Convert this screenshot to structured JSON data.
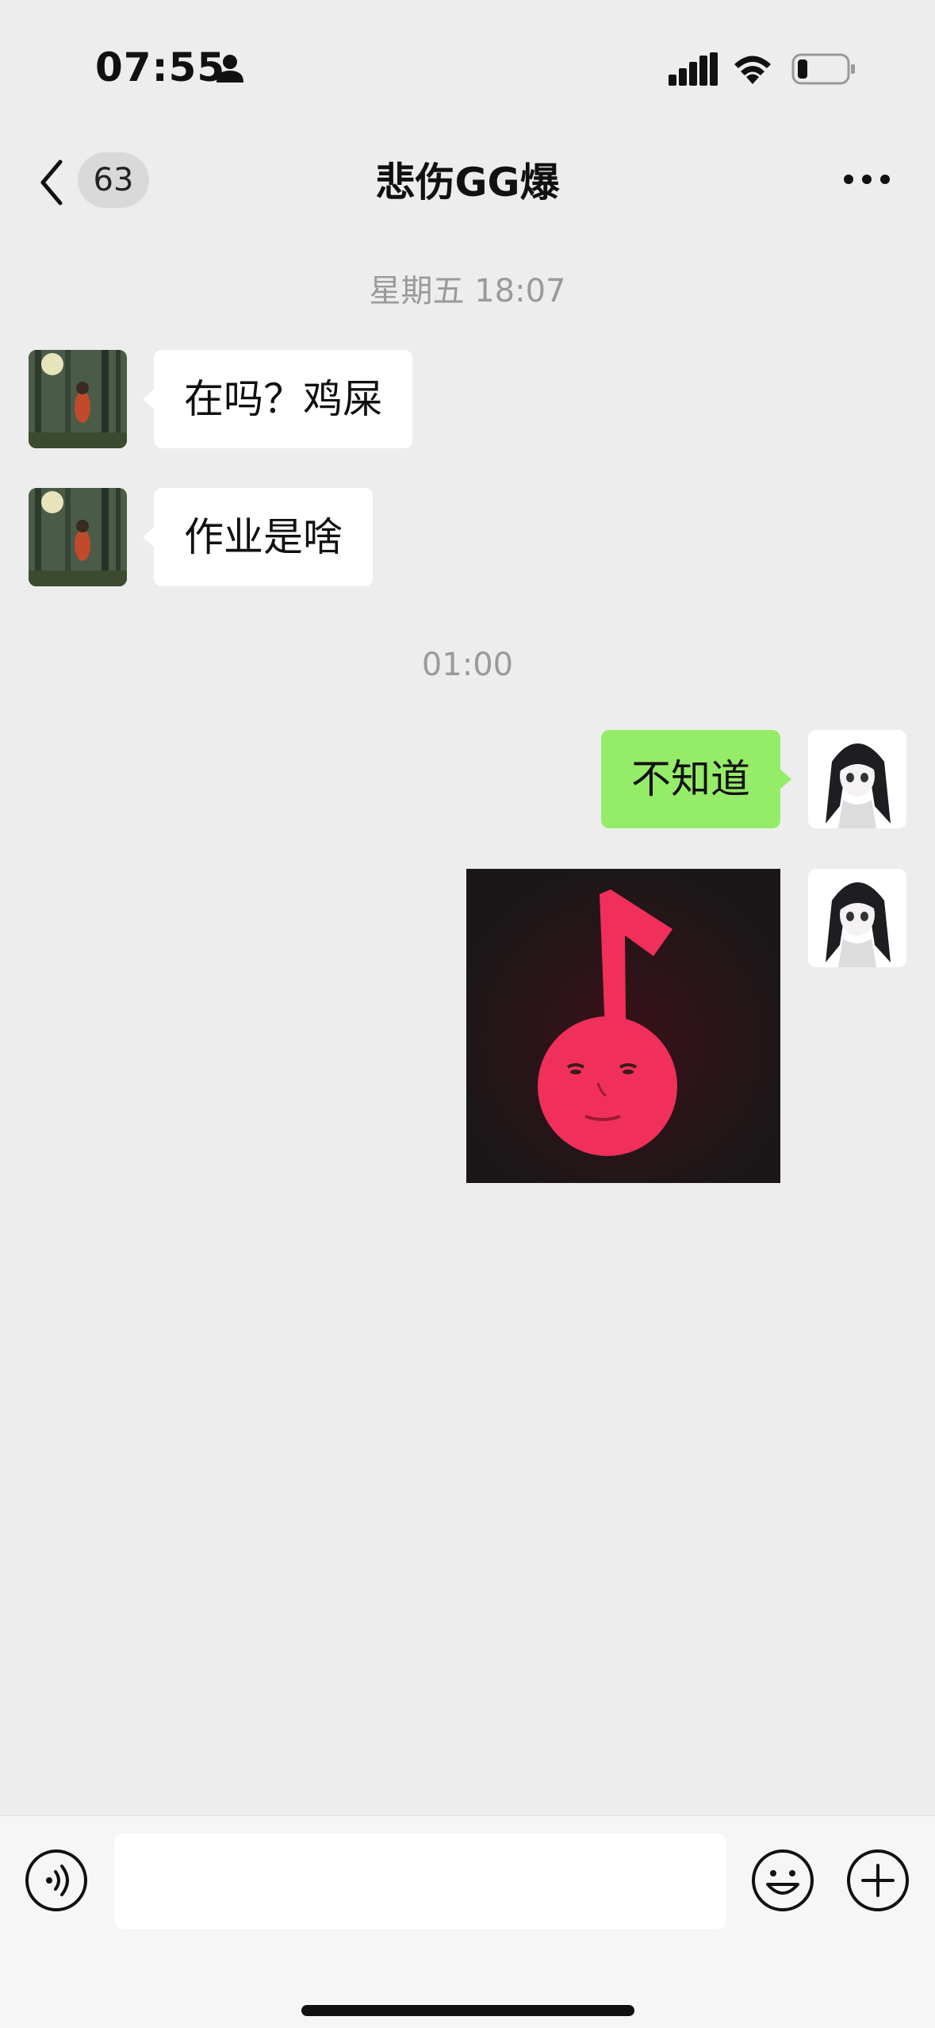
{
  "status_bar": {
    "time": "07:55",
    "person_icon": "person-icon",
    "signal_icon": "cellular-signal-icon",
    "wifi_icon": "wifi-icon",
    "battery_icon": "battery-low-icon"
  },
  "nav": {
    "back_icon": "chevron-left-icon",
    "unread_count": "63",
    "title": "悲伤GG爆",
    "more_icon": "more-dots-icon"
  },
  "messages": [
    {
      "type": "timestamp",
      "text": "星期五 18:07"
    },
    {
      "type": "message",
      "side": "left",
      "text": "在吗？鸡屎",
      "avatar": "forest-photo-avatar"
    },
    {
      "type": "message",
      "side": "left",
      "text": "作业是啥",
      "avatar": "forest-photo-avatar"
    },
    {
      "type": "timestamp",
      "text": "01:00"
    },
    {
      "type": "message",
      "side": "right",
      "text": "不知道",
      "avatar": "anime-girl-avatar"
    },
    {
      "type": "sticker",
      "side": "right",
      "sticker": "red-music-note-face-sticker",
      "avatar": "anime-girl-avatar"
    }
  ],
  "input_bar": {
    "voice_icon": "voice-input-icon",
    "text_value": "",
    "emoji_icon": "emoji-icon",
    "plus_icon": "plus-circle-icon"
  },
  "colors": {
    "background": "#ededed",
    "sent_bubble": "#95ec69",
    "received_bubble": "#ffffff",
    "timestamp_text": "#9a9a9a",
    "sticker_note": "#f0305a"
  }
}
